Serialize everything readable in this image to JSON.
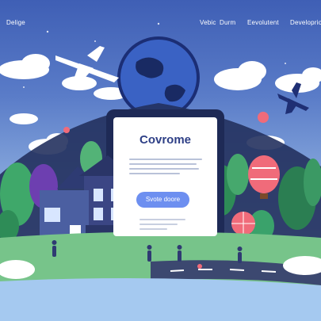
{
  "nav": {
    "brand": "Delige",
    "links": [
      "Vebic",
      "Durm",
      "Eevolutent",
      "Developrio"
    ]
  },
  "hero": {
    "title": "Covrome",
    "button_label": "Svote doore"
  },
  "colors": {
    "sky_top": "#3f5fb5",
    "sky_bottom": "#c9dcf2",
    "accent": "#6d8ff0",
    "title_navy": "#2e3f86"
  }
}
